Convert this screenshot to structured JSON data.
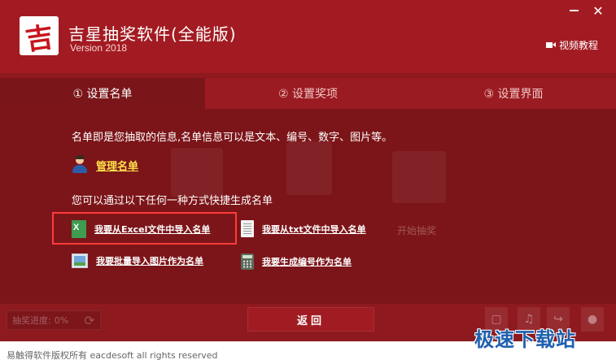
{
  "header": {
    "logo_char": "吉",
    "title": "吉星抽奖软件(全能版)",
    "version": "Version 2018",
    "video_link": "视频教程",
    "close_glyph": "✕"
  },
  "tabs": [
    {
      "label": "① 设置名单",
      "active": true
    },
    {
      "label": "② 设置奖项",
      "active": false
    },
    {
      "label": "③ 设置界面",
      "active": false
    }
  ],
  "content": {
    "description": "名单即是您抽取的信息,名单信息可以是文本、编号、数字、图片等。",
    "manage_link": "管理名单",
    "sub_description": "您可以通过以下任何一种方式快捷生成名单",
    "options": {
      "excel": "我要从Excel文件中导入名单",
      "txt": "我要从txt文件中导入名单",
      "images": "我要批量导入图片作为名单",
      "numbers": "我要生成编号作为名单"
    },
    "start_label": "开始抽奖"
  },
  "bottom": {
    "progress_label": "抽奖进度:",
    "progress_value": "0%",
    "back_button": "返回"
  },
  "status": {
    "copyright": "易触得软件版权所有 eacdesoft all rights reserved"
  },
  "watermark": "极速下载站",
  "colors": {
    "primary": "#8e1a1f",
    "header": "#a31b22",
    "link_yellow": "#ffe04a",
    "highlight": "#ff3b3b"
  }
}
